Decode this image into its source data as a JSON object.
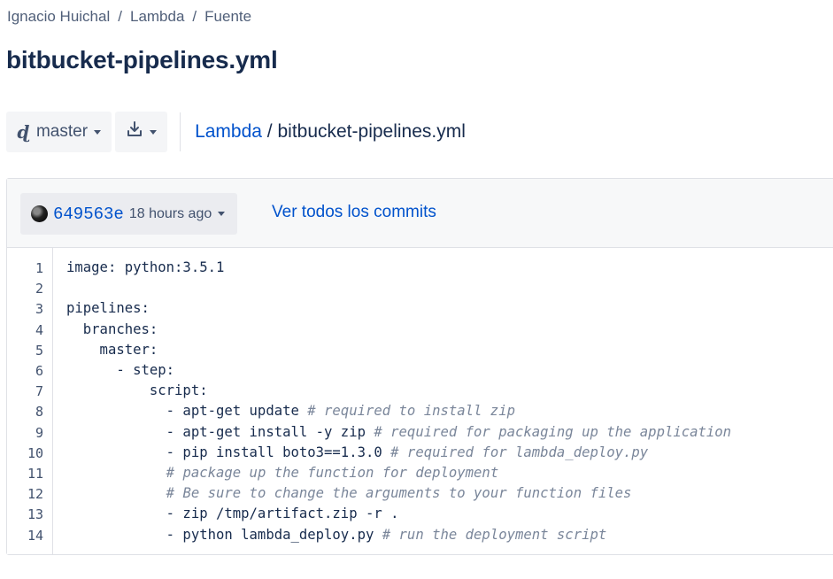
{
  "breadcrumb": {
    "items": [
      "Ignacio Huichal",
      "Lambda",
      "Fuente"
    ],
    "separator": "/"
  },
  "page_title": "bitbucket-pipelines.yml",
  "toolbar": {
    "branch_label": "master",
    "branch_icon": "branch-icon",
    "download_icon": "download-icon",
    "path_repo": "Lambda",
    "path_sep": " / ",
    "path_file": "bitbucket-pipelines.yml"
  },
  "commit": {
    "hash": "649563e",
    "time": "18 hours ago",
    "view_all": "Ver todos los commits"
  },
  "code": {
    "lines": [
      {
        "n": "1",
        "text": "image: python:3.5.1",
        "comment": ""
      },
      {
        "n": "2",
        "text": "",
        "comment": ""
      },
      {
        "n": "3",
        "text": "pipelines:",
        "comment": ""
      },
      {
        "n": "4",
        "text": "  branches:",
        "comment": ""
      },
      {
        "n": "5",
        "text": "    master:",
        "comment": ""
      },
      {
        "n": "6",
        "text": "      - step:",
        "comment": ""
      },
      {
        "n": "7",
        "text": "          script:",
        "comment": ""
      },
      {
        "n": "8",
        "text": "            - apt-get update ",
        "comment": "# required to install zip"
      },
      {
        "n": "9",
        "text": "            - apt-get install -y zip ",
        "comment": "# required for packaging up the application"
      },
      {
        "n": "10",
        "text": "            - pip install boto3==1.3.0 ",
        "comment": "# required for lambda_deploy.py"
      },
      {
        "n": "11",
        "text": "            ",
        "comment": "# package up the function for deployment"
      },
      {
        "n": "12",
        "text": "            ",
        "comment": "# Be sure to change the arguments to your function files"
      },
      {
        "n": "13",
        "text": "            - zip /tmp/artifact.zip -r .",
        "comment": ""
      },
      {
        "n": "14",
        "text": "            - python lambda_deploy.py ",
        "comment": "# run the deployment script"
      }
    ]
  },
  "colors": {
    "link": "#0052cc",
    "text": "#172b4d",
    "muted": "#505f79",
    "comment": "#7a869a",
    "button_bg": "#f4f5f7"
  }
}
